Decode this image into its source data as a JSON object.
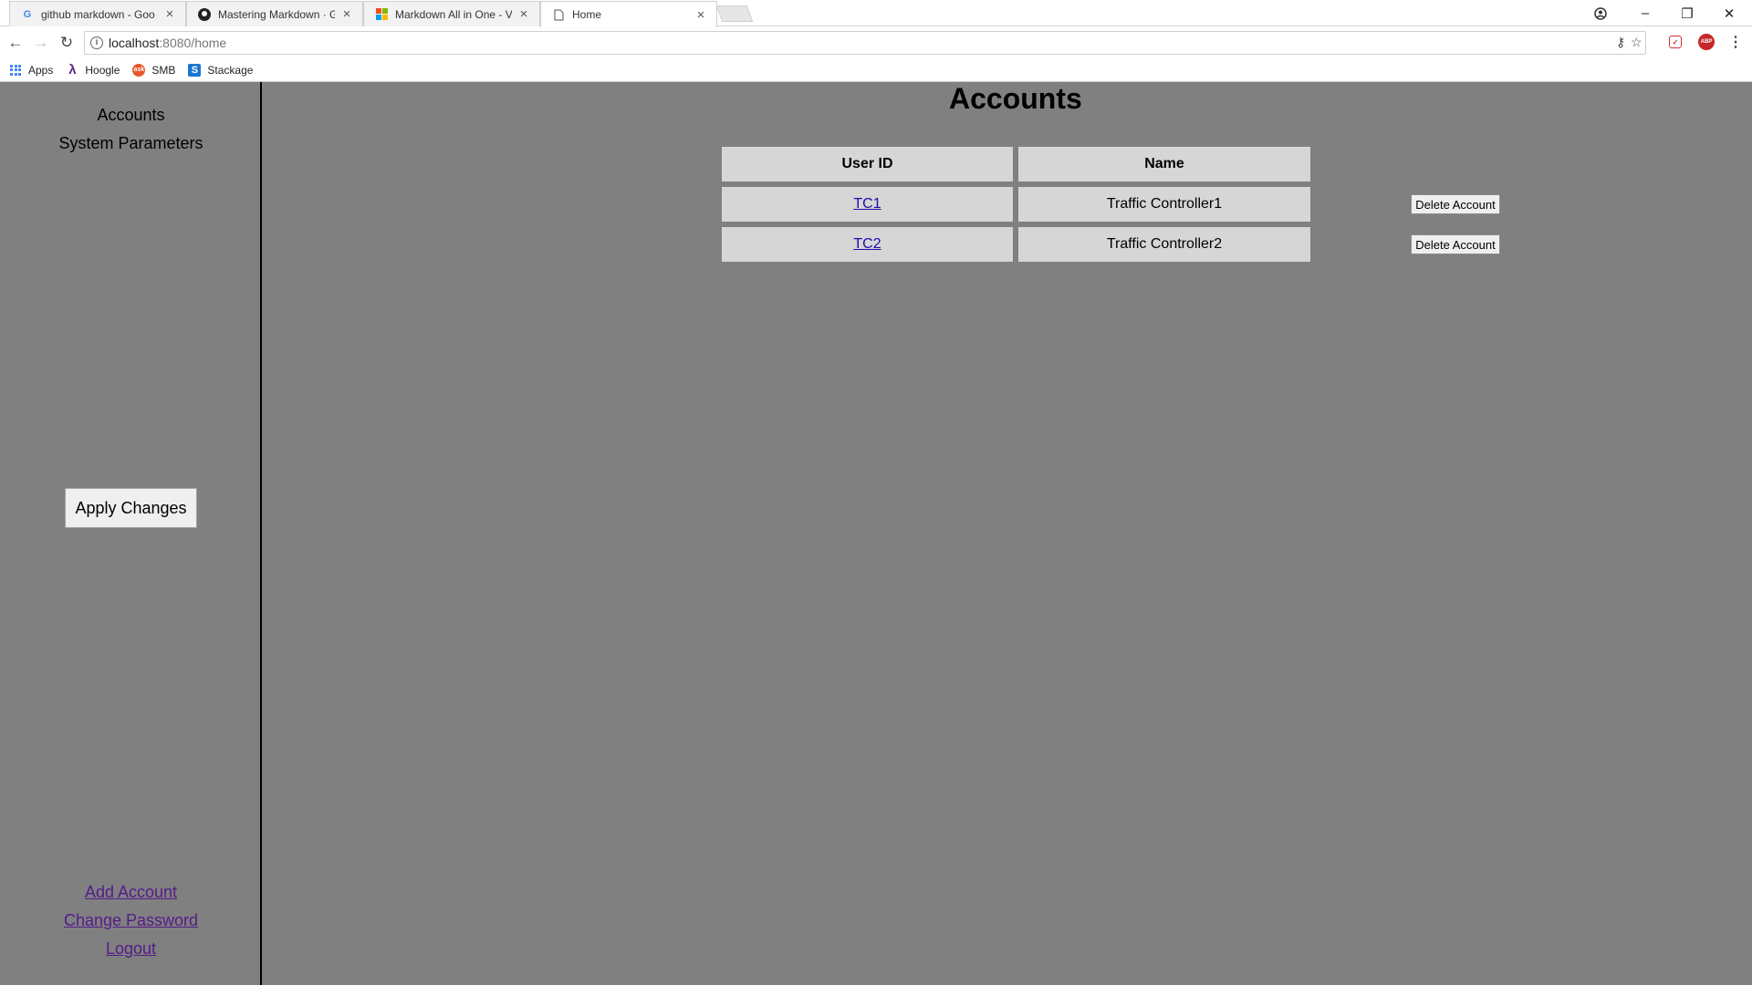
{
  "browser": {
    "tabs": [
      {
        "title": "github markdown - Goo"
      },
      {
        "title": "Mastering Markdown · G"
      },
      {
        "title": "Markdown All in One - V"
      },
      {
        "title": "Home"
      }
    ],
    "url_host": "localhost",
    "url_path": ":8080/home",
    "bookmarks": [
      {
        "label": "Apps",
        "icon": "apps-grid-icon"
      },
      {
        "label": "Hoogle",
        "icon": "lambda-icon"
      },
      {
        "label": "SMB",
        "icon": "smb-icon"
      },
      {
        "label": "Stackage",
        "icon": "stackage-icon"
      }
    ]
  },
  "sidebar": {
    "nav": [
      "Accounts",
      "System Parameters"
    ],
    "apply_label": "Apply Changes",
    "links": [
      "Add Account",
      "Change Password",
      "Logout"
    ]
  },
  "main": {
    "title": "Accounts",
    "columns": [
      "User ID",
      "Name"
    ],
    "rows": [
      {
        "user_id": "TC1",
        "name": "Traffic Controller1",
        "action": "Delete Account"
      },
      {
        "user_id": "TC2",
        "name": "Traffic Controller2",
        "action": "Delete Account"
      }
    ]
  },
  "colors": {
    "page_background": "#808080",
    "cell_background": "#d6d6d6",
    "link": "#1a0dab",
    "visited_link": "#551a8b"
  }
}
